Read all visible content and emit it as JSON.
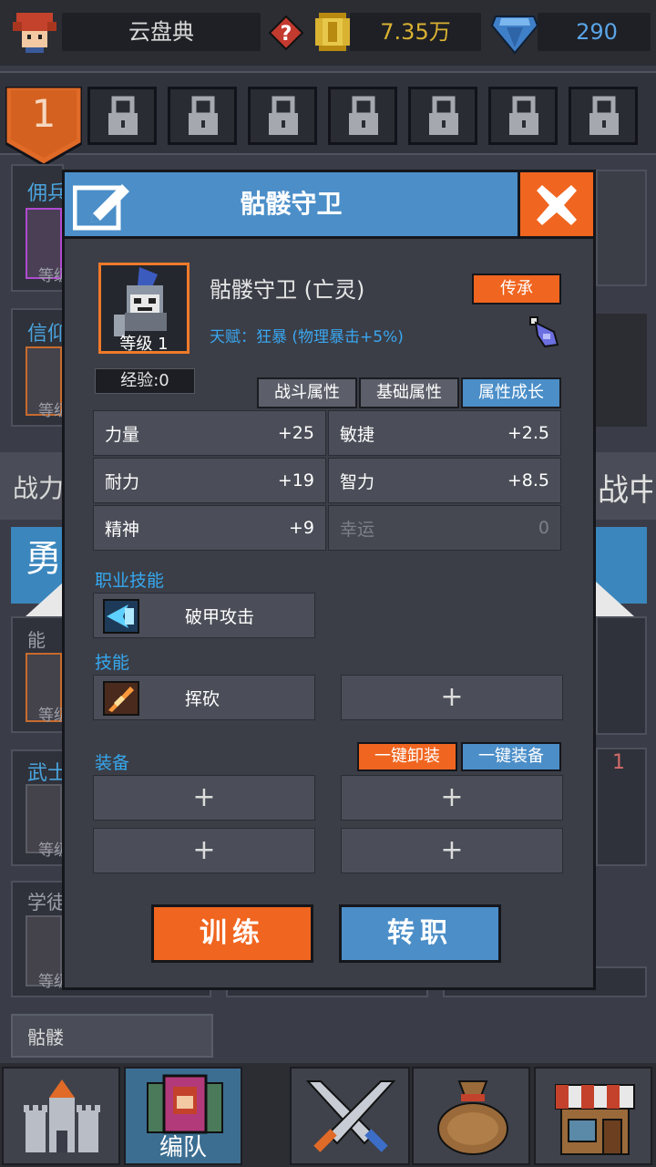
{
  "topbar": {
    "player_name": "云盘典",
    "gold": "7.35万",
    "gems": "290",
    "help_icon": "question-icon",
    "gold_icon": "coin-icon",
    "gem_icon": "diamond-icon"
  },
  "tabs": {
    "active_number": "1",
    "locked_count": 7
  },
  "background": {
    "left_labels": [
      "佣兵",
      "信仰",
      "武士",
      "学徒"
    ],
    "left_level": "等级",
    "power_label": "战力",
    "right_text": "战中",
    "hero_label": "勇",
    "list_tag": "能",
    "bottom_item": "骷髅",
    "right_badge": "1"
  },
  "dialog": {
    "title": "骷髅守卫",
    "hero_name": "骷髅守卫 (亡灵)",
    "level": "等级 1",
    "talent": "天赋：狂暴 (物理暴击+5%)",
    "inherit": "传承",
    "exp": "经验:0",
    "attr_tabs": [
      "战斗属性",
      "基础属性",
      "属性成长"
    ],
    "active_attr_tab": 2,
    "stats": [
      {
        "name": "力量",
        "value": "+25"
      },
      {
        "name": "敏捷",
        "value": "+2.5"
      },
      {
        "name": "耐力",
        "value": "+19"
      },
      {
        "name": "智力",
        "value": "+8.5"
      },
      {
        "name": "精神",
        "value": "+9"
      },
      {
        "name": "幸运",
        "value": "0"
      }
    ],
    "class_skill_label": "职业技能",
    "class_skill": "破甲攻击",
    "skill_label": "技能",
    "skill": "挥砍",
    "plus": "+",
    "equip_label": "装备",
    "unequip_all": "一键卸装",
    "equip_all": "一键装备",
    "train": "训练",
    "change_class": "转职"
  },
  "bottomnav": {
    "items": [
      "castle-icon",
      "team-icon",
      "battle-icon",
      "bag-icon",
      "shop-icon"
    ],
    "active_label": "编队"
  },
  "colors": {
    "accent_orange": "#f0651f",
    "accent_blue": "#4b8ec8",
    "text_blue": "#36a8ef",
    "gold": "#d9b232"
  }
}
